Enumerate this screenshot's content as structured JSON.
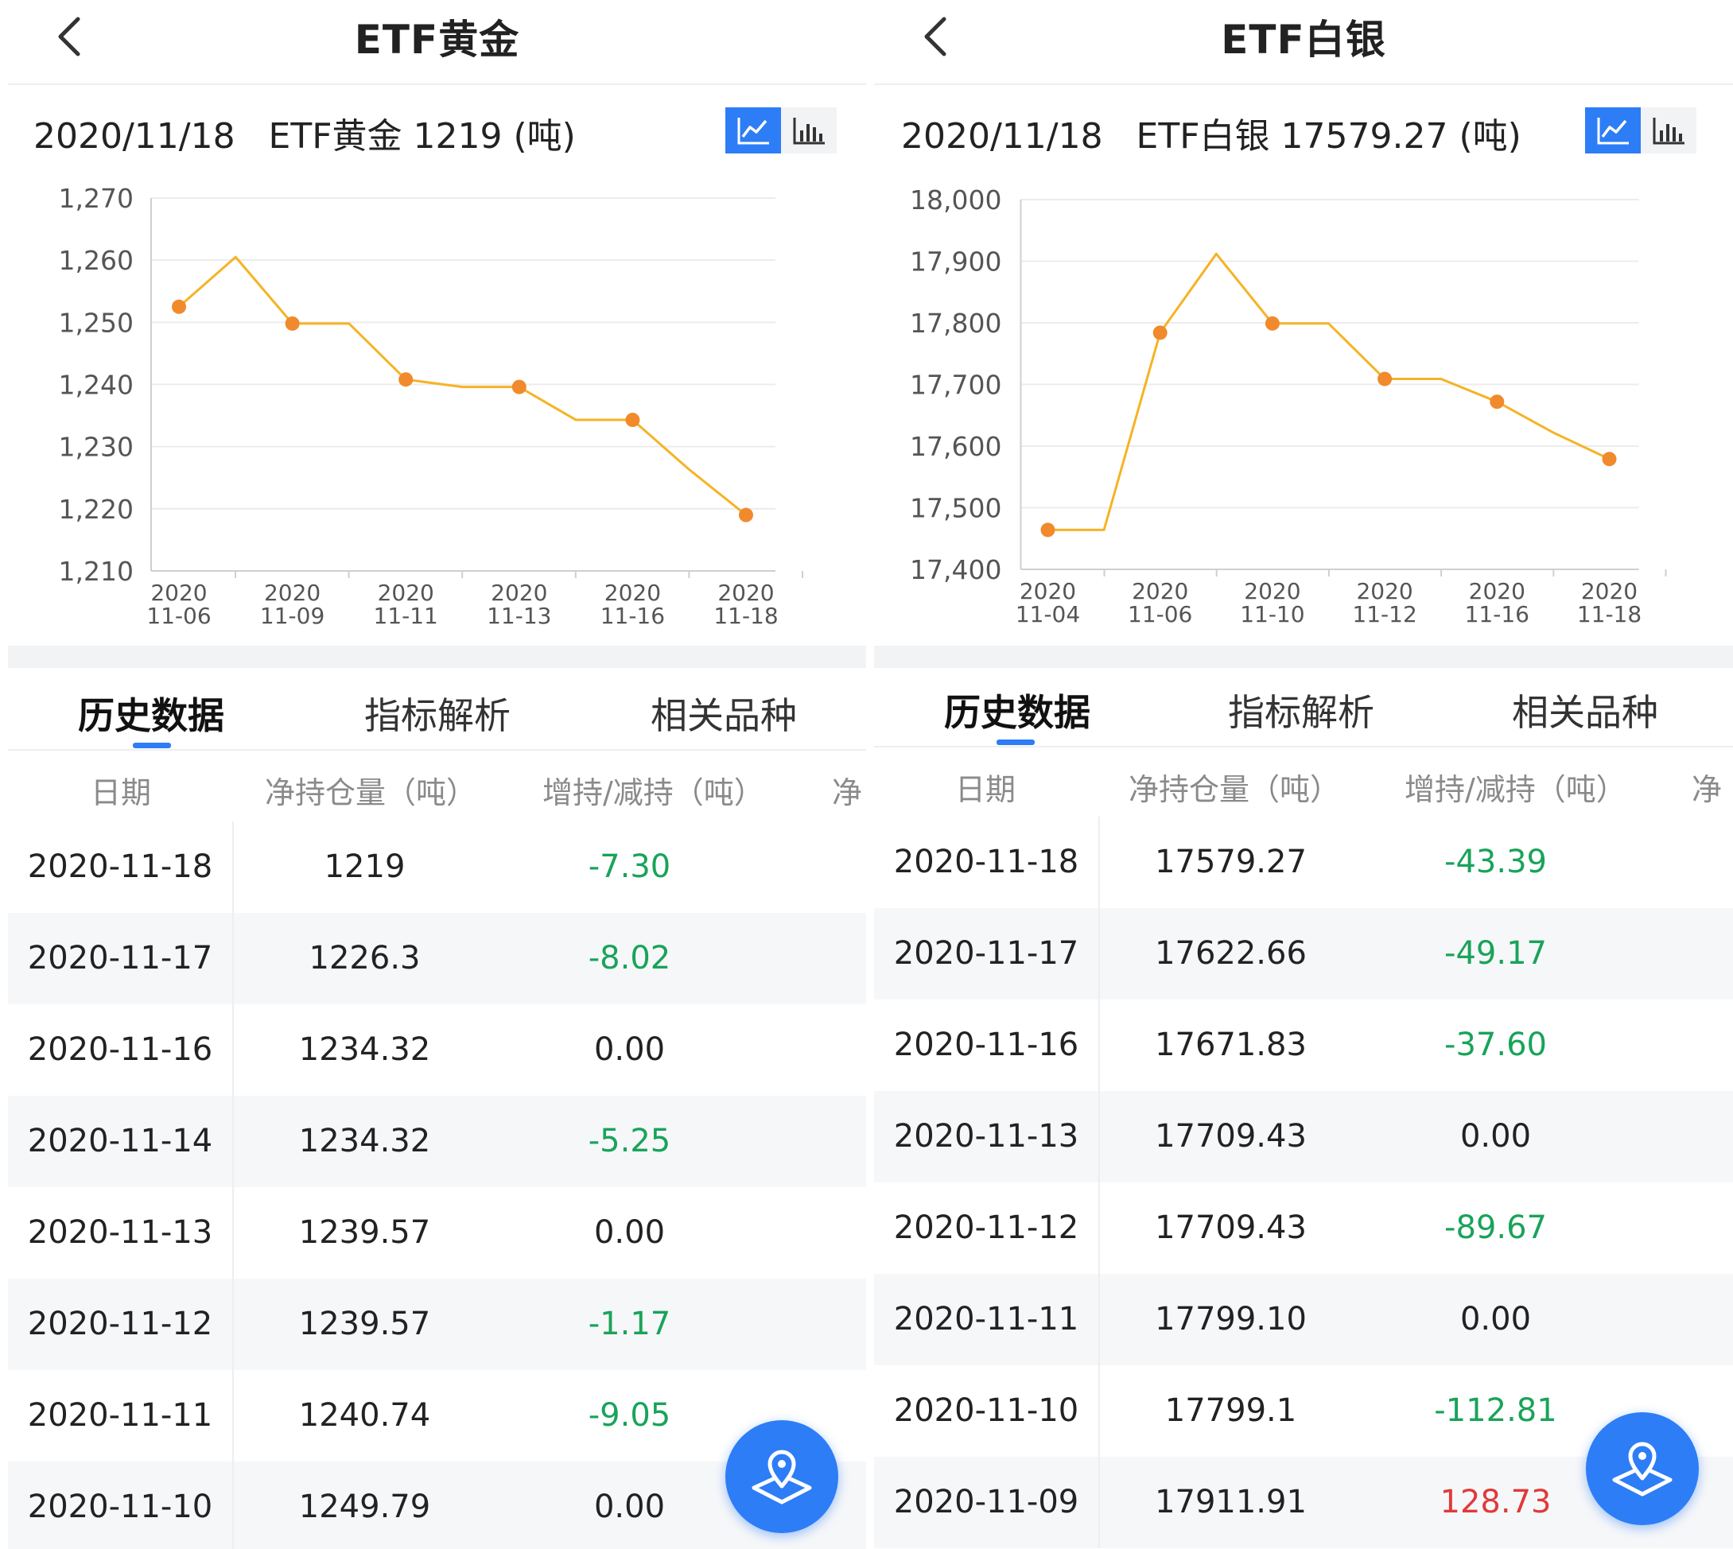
{
  "panels": [
    {
      "title": "ETF黄金",
      "summary": "2020/11/18   ETF黄金 1219 (吨)",
      "accent": "#2d7df6",
      "tabs": [
        "历史数据",
        "指标解析",
        "相关品种"
      ],
      "columns": [
        "日期",
        "净持仓量（吨）",
        "增持/减持（吨）",
        "净"
      ],
      "rows": [
        {
          "date": "2020-11-18",
          "holding": "1219",
          "change": "-7.30",
          "dir": "neg"
        },
        {
          "date": "2020-11-17",
          "holding": "1226.3",
          "change": "-8.02",
          "dir": "neg"
        },
        {
          "date": "2020-11-16",
          "holding": "1234.32",
          "change": "0.00",
          "dir": "zero"
        },
        {
          "date": "2020-11-14",
          "holding": "1234.32",
          "change": "-5.25",
          "dir": "neg"
        },
        {
          "date": "2020-11-13",
          "holding": "1239.57",
          "change": "0.00",
          "dir": "zero"
        },
        {
          "date": "2020-11-12",
          "holding": "1239.57",
          "change": "-1.17",
          "dir": "neg"
        },
        {
          "date": "2020-11-11",
          "holding": "1240.74",
          "change": "-9.05",
          "dir": "neg"
        },
        {
          "date": "2020-11-10",
          "holding": "1249.79",
          "change": "0.00",
          "dir": "zero"
        }
      ]
    },
    {
      "title": "ETF白银",
      "summary": "2020/11/18   ETF白银 17579.27 (吨)",
      "accent": "#2d7df6",
      "tabs": [
        "历史数据",
        "指标解析",
        "相关品种"
      ],
      "columns": [
        "日期",
        "净持仓量（吨）",
        "增持/减持（吨）",
        "净"
      ],
      "rows": [
        {
          "date": "2020-11-18",
          "holding": "17579.27",
          "change": "-43.39",
          "dir": "neg"
        },
        {
          "date": "2020-11-17",
          "holding": "17622.66",
          "change": "-49.17",
          "dir": "neg"
        },
        {
          "date": "2020-11-16",
          "holding": "17671.83",
          "change": "-37.60",
          "dir": "neg"
        },
        {
          "date": "2020-11-13",
          "holding": "17709.43",
          "change": "0.00",
          "dir": "zero"
        },
        {
          "date": "2020-11-12",
          "holding": "17709.43",
          "change": "-89.67",
          "dir": "neg"
        },
        {
          "date": "2020-11-11",
          "holding": "17799.10",
          "change": "0.00",
          "dir": "zero"
        },
        {
          "date": "2020-11-10",
          "holding": "17799.1",
          "change": "-112.81",
          "dir": "neg"
        },
        {
          "date": "2020-11-09",
          "holding": "17911.91",
          "change": "128.73",
          "dir": "pos"
        }
      ]
    }
  ],
  "chart_data": [
    {
      "type": "line",
      "title": "",
      "ylim": [
        1210,
        1270
      ],
      "yticks": [
        "1,210",
        "1,220",
        "1,230",
        "1,240",
        "1,250",
        "1,260",
        "1,270"
      ],
      "ytick_values": [
        1210,
        1220,
        1230,
        1240,
        1250,
        1260,
        1270
      ],
      "xtick_labels": [
        [
          "2020",
          "11-06"
        ],
        [
          "2020",
          "11-09"
        ],
        [
          "2020",
          "11-11"
        ],
        [
          "2020",
          "11-13"
        ],
        [
          "2020",
          "11-16"
        ],
        [
          "2020",
          "11-18"
        ]
      ],
      "values": [
        1252.5,
        1260.5,
        1249.8,
        1249.8,
        1240.8,
        1239.6,
        1239.6,
        1234.3,
        1234.3,
        1226.3,
        1219
      ],
      "markers": [
        0,
        2,
        4,
        6,
        8,
        10
      ],
      "line_color": "#f5b324",
      "marker_color": "#f08a2c",
      "grid": true
    },
    {
      "type": "line",
      "title": "",
      "ylim": [
        17400,
        18000
      ],
      "yticks": [
        "17,400",
        "17,500",
        "17,600",
        "17,700",
        "17,800",
        "17,900",
        "18,000"
      ],
      "ytick_values": [
        17400,
        17500,
        17600,
        17700,
        17800,
        17900,
        18000
      ],
      "xtick_labels": [
        [
          "2020",
          "11-04"
        ],
        [
          "2020",
          "11-06"
        ],
        [
          "2020",
          "11-10"
        ],
        [
          "2020",
          "11-12"
        ],
        [
          "2020",
          "11-16"
        ],
        [
          "2020",
          "11-18"
        ]
      ],
      "values": [
        17464,
        17464,
        17784,
        17912,
        17799,
        17799,
        17709,
        17709,
        17672,
        17622,
        17579
      ],
      "markers": [
        0,
        2,
        4,
        6,
        8,
        10
      ],
      "line_color": "#f5b324",
      "marker_color": "#f08a2c",
      "grid": true
    }
  ],
  "fab": {
    "icon": "map-pin-icon"
  },
  "icons": {
    "back": "chevron-left-icon",
    "line_chart": "line-chart-icon",
    "bar_chart": "bar-chart-icon"
  }
}
